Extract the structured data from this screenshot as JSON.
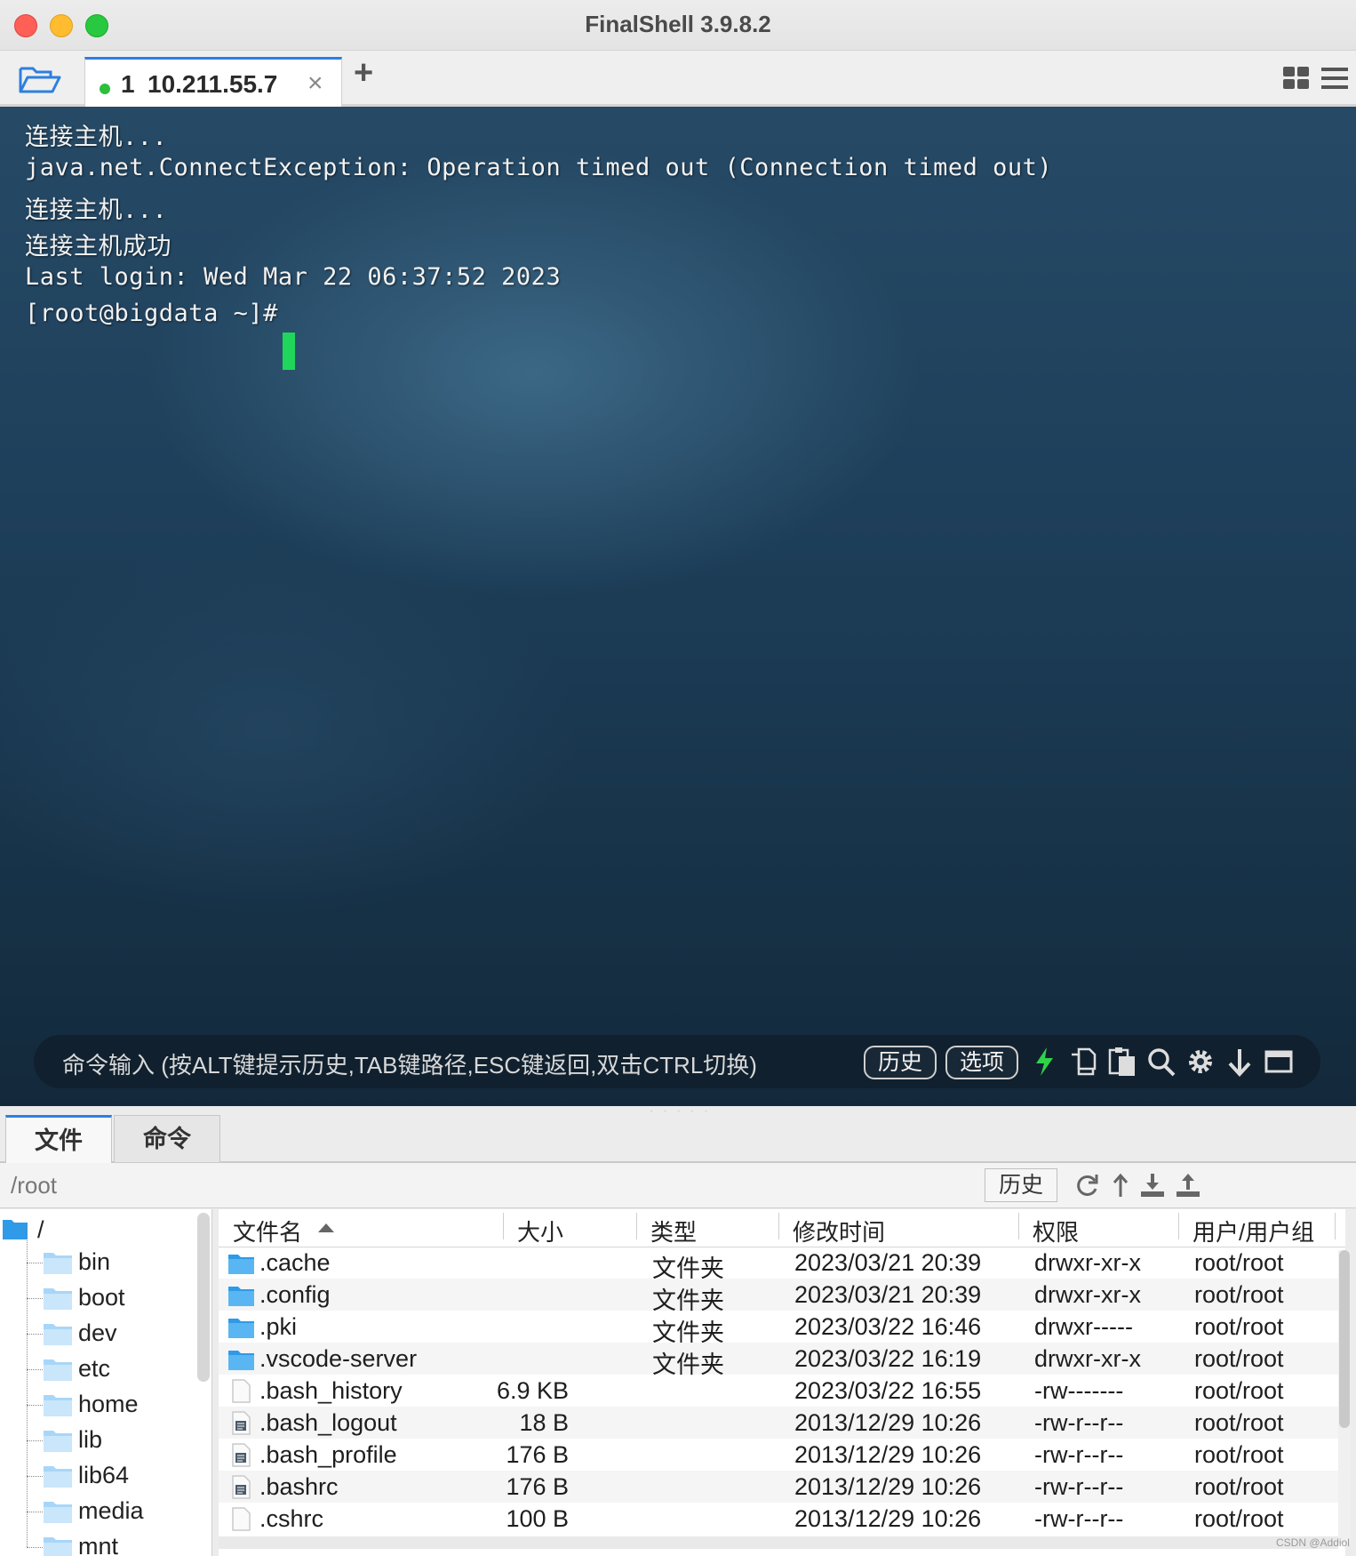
{
  "window": {
    "title": "FinalShell 3.9.8.2"
  },
  "tabs": [
    {
      "number": "1",
      "label": "10.211.55.7",
      "close": "×",
      "status_color": "#2bbf3a"
    }
  ],
  "add_tab": "+",
  "terminal": {
    "lines": [
      "连接主机...",
      "java.net.ConnectException: Operation timed out (Connection timed out)",
      "连接主机...",
      "连接主机成功",
      "Last login: Wed Mar 22 06:37:52 2023",
      "[root@bigdata ~]#"
    ],
    "cursor_color": "#1fd65a",
    "command_bar": {
      "hint": "命令输入 (按ALT键提示历史,TAB键路径,ESC键返回,双击CTRL切换)",
      "history_button": "历史",
      "options_button": "选项",
      "icons": [
        "lightning-icon",
        "copy-icon",
        "paste-icon",
        "search-icon",
        "gear-icon",
        "download-arrow-icon",
        "window-icon"
      ]
    }
  },
  "bottom_tabs": [
    {
      "label": "文件"
    },
    {
      "label": "命令"
    }
  ],
  "path_bar": {
    "path": "/root",
    "history_button": "历史",
    "icons": [
      "refresh-icon",
      "up-dir-icon",
      "download-icon",
      "upload-icon"
    ]
  },
  "tree": {
    "root": "/",
    "items": [
      "bin",
      "boot",
      "dev",
      "etc",
      "home",
      "lib",
      "lib64",
      "media",
      "mnt"
    ]
  },
  "file_table": {
    "columns": [
      "文件名",
      "大小",
      "类型",
      "修改时间",
      "权限",
      "用户/用户组"
    ],
    "rows": [
      {
        "name": ".cache",
        "size": "",
        "type": "文件夹",
        "mtime": "2023/03/21 20:39",
        "perm": "drwxr-xr-x",
        "owner": "root/root",
        "icon": "folder"
      },
      {
        "name": ".config",
        "size": "",
        "type": "文件夹",
        "mtime": "2023/03/21 20:39",
        "perm": "drwxr-xr-x",
        "owner": "root/root",
        "icon": "folder"
      },
      {
        "name": ".pki",
        "size": "",
        "type": "文件夹",
        "mtime": "2023/03/22 16:46",
        "perm": "drwxr-----",
        "owner": "root/root",
        "icon": "folder"
      },
      {
        "name": ".vscode-server",
        "size": "",
        "type": "文件夹",
        "mtime": "2023/03/22 16:19",
        "perm": "drwxr-xr-x",
        "owner": "root/root",
        "icon": "folder"
      },
      {
        "name": ".bash_history",
        "size": "6.9 KB",
        "type": "",
        "mtime": "2023/03/22 16:55",
        "perm": "-rw-------",
        "owner": "root/root",
        "icon": "blank-file"
      },
      {
        "name": ".bash_logout",
        "size": "18 B",
        "type": "",
        "mtime": "2013/12/29 10:26",
        "perm": "-rw-r--r--",
        "owner": "root/root",
        "icon": "text-file"
      },
      {
        "name": ".bash_profile",
        "size": "176 B",
        "type": "",
        "mtime": "2013/12/29 10:26",
        "perm": "-rw-r--r--",
        "owner": "root/root",
        "icon": "text-file"
      },
      {
        "name": ".bashrc",
        "size": "176 B",
        "type": "",
        "mtime": "2013/12/29 10:26",
        "perm": "-rw-r--r--",
        "owner": "root/root",
        "icon": "text-file"
      },
      {
        "name": ".cshrc",
        "size": "100 B",
        "type": "",
        "mtime": "2013/12/29 10:26",
        "perm": "-rw-r--r--",
        "owner": "root/root",
        "icon": "blank-file"
      }
    ]
  },
  "watermark": "CSDN @Addiol",
  "colors": {
    "accent": "#2d7fe0",
    "folder": "#3aa3f0",
    "terminal_bg": "#1e3f5a"
  }
}
